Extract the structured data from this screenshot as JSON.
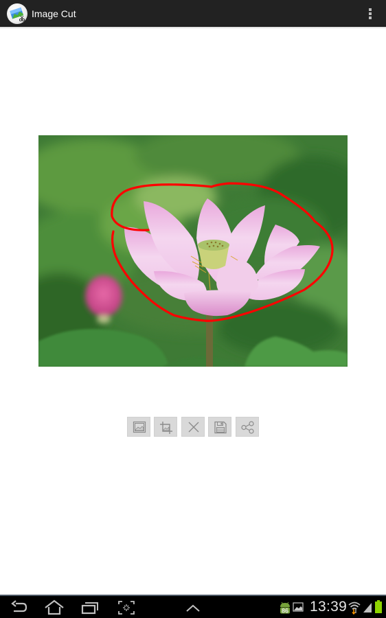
{
  "app": {
    "title": "Image Cut",
    "icon": "image-cut-app-icon",
    "overflow_menu_icon": "overflow-menu-icon"
  },
  "photo": {
    "description": "Pink lotus flower against green lotus leaves with a red freehand selection outline around the flower",
    "selection_outline_color": "#ff0000"
  },
  "toolbar": {
    "buttons": [
      {
        "name": "open-image",
        "icon": "image-icon"
      },
      {
        "name": "crop",
        "icon": "crop-icon"
      },
      {
        "name": "clear",
        "icon": "close-icon"
      },
      {
        "name": "save",
        "icon": "save-icon"
      },
      {
        "name": "share",
        "icon": "share-icon"
      }
    ]
  },
  "navigation_bar": {
    "buttons": [
      {
        "name": "back",
        "icon": "back-icon"
      },
      {
        "name": "home",
        "icon": "home-icon"
      },
      {
        "name": "recent-apps",
        "icon": "recent-apps-icon"
      },
      {
        "name": "screenshot",
        "icon": "screenshot-icon"
      },
      {
        "name": "expand",
        "icon": "chevron-up-icon"
      }
    ],
    "status": {
      "notification_badge": "86",
      "time": "13:39",
      "icons": [
        "android-notification-icon",
        "gallery-notification-icon",
        "wifi-icon",
        "signal-icon",
        "battery-icon"
      ],
      "battery_color": "#8fd400"
    }
  },
  "colors": {
    "action_bar": "#222222",
    "toolbar_button": "#d9d9d9",
    "nav_bar": "#000000",
    "selection": "#ff0000"
  }
}
